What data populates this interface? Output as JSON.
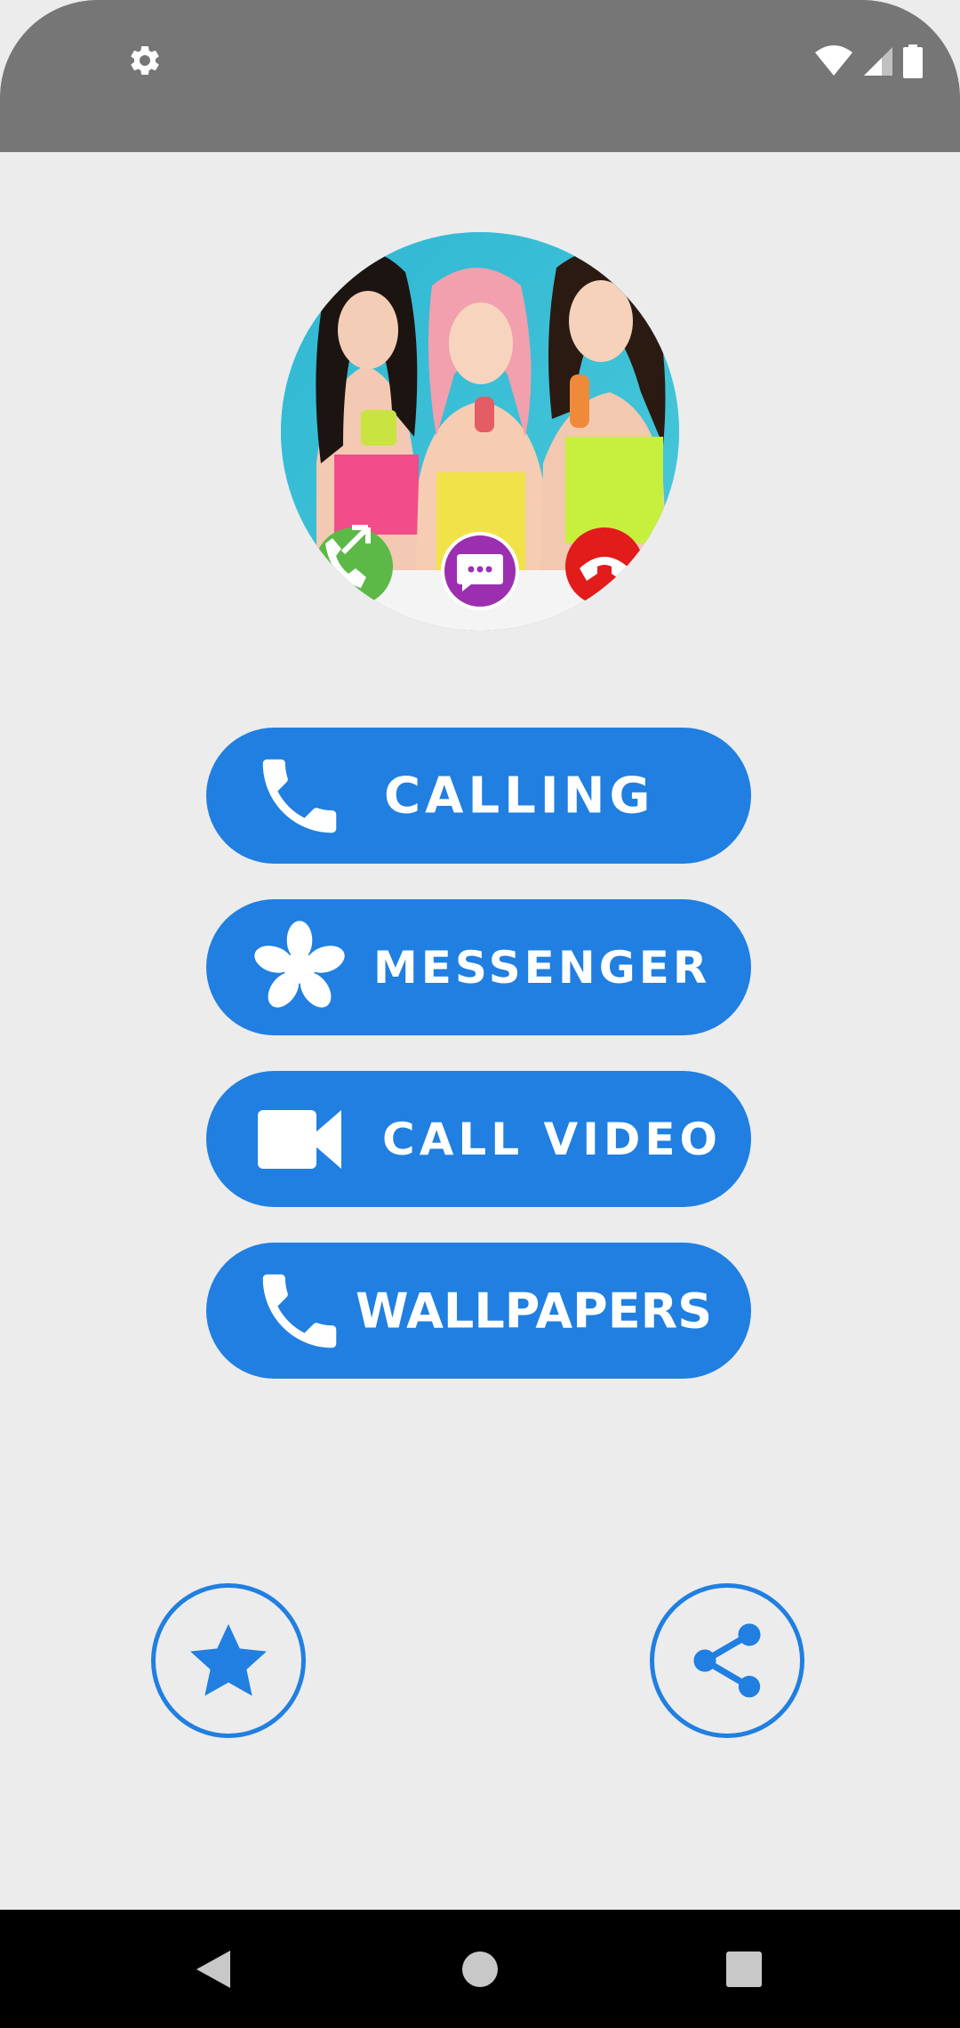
{
  "status_bar": {
    "left_icon": "settings-gear-icon",
    "right_icons": [
      "wifi-icon",
      "cellular-signal-icon",
      "battery-icon"
    ]
  },
  "avatar": {
    "overlay_icons": [
      "accept-call-icon",
      "message-icon",
      "decline-call-icon"
    ],
    "colors": {
      "background": "#37c0d6",
      "accept": "#5cb947",
      "message": "#9b2fb0",
      "decline": "#e21b1b"
    }
  },
  "menu": {
    "calling": {
      "label": "CALLING",
      "icon": "phone-icon"
    },
    "messenger": {
      "label": "MESSENGER",
      "icon": "asterisk-flower-icon"
    },
    "call_video": {
      "label": "CALL VIDEO",
      "icon": "video-camera-icon"
    },
    "wallpapers": {
      "label": "WALLPAPERS",
      "icon": "phone-icon"
    }
  },
  "bottom_actions": {
    "rate": {
      "icon": "star-icon"
    },
    "share": {
      "icon": "share-icon"
    }
  },
  "nav_bar": {
    "buttons": [
      "back-icon",
      "home-icon",
      "recents-icon"
    ]
  },
  "theme": {
    "accent": "#207fe0",
    "background": "#ececec",
    "status_bar": "#767676",
    "nav_bar": "#000000"
  }
}
